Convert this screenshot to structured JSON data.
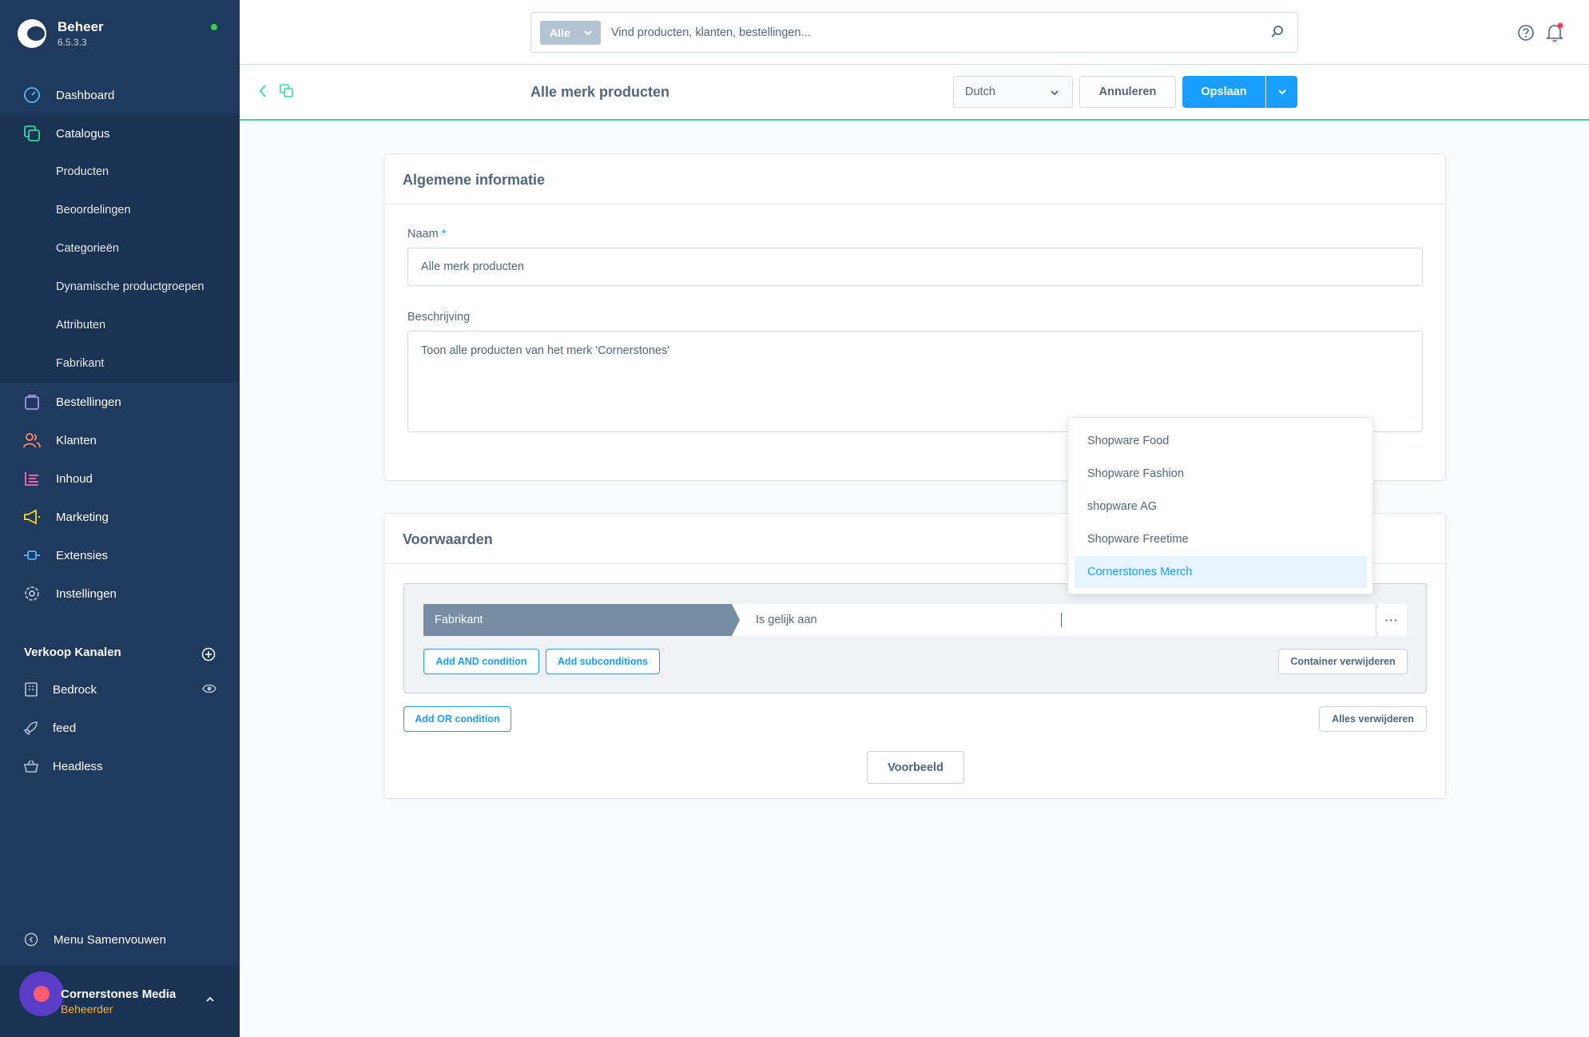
{
  "app": {
    "name": "Beheer",
    "version": "6.5.3.3"
  },
  "sidebar": {
    "items": [
      {
        "label": "Dashboard"
      },
      {
        "label": "Catalogus"
      },
      {
        "label": "Bestellingen"
      },
      {
        "label": "Klanten"
      },
      {
        "label": "Inhoud"
      },
      {
        "label": "Marketing"
      },
      {
        "label": "Extensies"
      },
      {
        "label": "Instellingen"
      }
    ],
    "catalog_sub": [
      {
        "label": "Producten"
      },
      {
        "label": "Beoordelingen"
      },
      {
        "label": "Categorieën"
      },
      {
        "label": "Dynamische productgroepen"
      },
      {
        "label": "Attributen"
      },
      {
        "label": "Fabrikant"
      }
    ],
    "sales_channels_title": "Verkoop Kanalen",
    "channels": [
      {
        "label": "Bedrock"
      },
      {
        "label": "feed"
      },
      {
        "label": "Headless"
      }
    ],
    "collapse_label": "Menu Samenvouwen",
    "user": {
      "name": "Cornerstones Media",
      "role": "Beheerder"
    }
  },
  "topbar": {
    "search_type": "Alle",
    "search_placeholder": "Vind producten, klanten, bestellingen..."
  },
  "actionbar": {
    "title": "Alle merk producten",
    "language": "Dutch",
    "cancel_label": "Annuleren",
    "save_label": "Opslaan"
  },
  "general": {
    "title": "Algemene informatie",
    "name_label": "Naam",
    "name_required": "*",
    "name_value": "Alle merk producten",
    "description_label": "Beschrijving",
    "description_value": "Toon alle producten van het merk 'Cornerstones'"
  },
  "conditions": {
    "title": "Voorwaarden",
    "field": "Fabrikant",
    "operator": "Is gelijk aan",
    "menu_label": "···",
    "add_and_label": "Add AND condition",
    "add_sub_label": "Add subconditions",
    "remove_container_label": "Container verwijderen",
    "add_or_label": "Add OR condition",
    "remove_all_label": "Alles verwijderen",
    "preview_label": "Voorbeeld"
  },
  "dropdown": {
    "options": [
      {
        "label": "Shopware Food"
      },
      {
        "label": "Shopware Fashion"
      },
      {
        "label": "shopware AG"
      },
      {
        "label": "Shopware Freetime"
      },
      {
        "label": "Cornerstones Merch"
      }
    ],
    "highlighted": "Cornerstones Merch"
  },
  "colors": {
    "sidebar_bg": "#1f3a5c",
    "primary": "#189eff",
    "accent_green": "#37d4a0",
    "status_online": "#37d046",
    "text": "#52667a"
  },
  "icons": {
    "dashboard": "gauge-icon",
    "catalog": "stack-icon",
    "orders": "bag-icon",
    "customers": "users-icon",
    "content": "content-icon",
    "marketing": "megaphone-icon",
    "extensions": "plug-icon",
    "settings": "gear-icon"
  }
}
